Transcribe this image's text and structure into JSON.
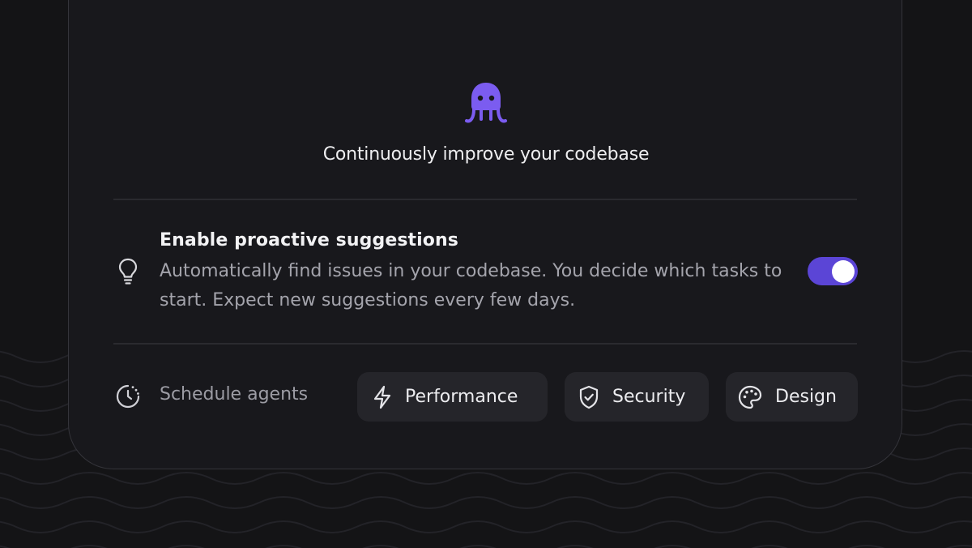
{
  "headline": "Continuously improve your codebase",
  "suggestions": {
    "title": "Enable proactive suggestions",
    "description": "Automatically find issues in your codebase. You decide which tasks to start. Expect new suggestions every few days.",
    "enabled": true
  },
  "schedule": {
    "label": "Schedule agents",
    "chips": [
      {
        "label": "Performance",
        "icon": "lightning-icon"
      },
      {
        "label": "Security",
        "icon": "shield-check-icon"
      },
      {
        "label": "Design",
        "icon": "palette-icon"
      }
    ]
  },
  "colors": {
    "accent": "#5b45d6",
    "logo": "#7b5cf0",
    "background": "#141416",
    "card": "#18181c"
  }
}
